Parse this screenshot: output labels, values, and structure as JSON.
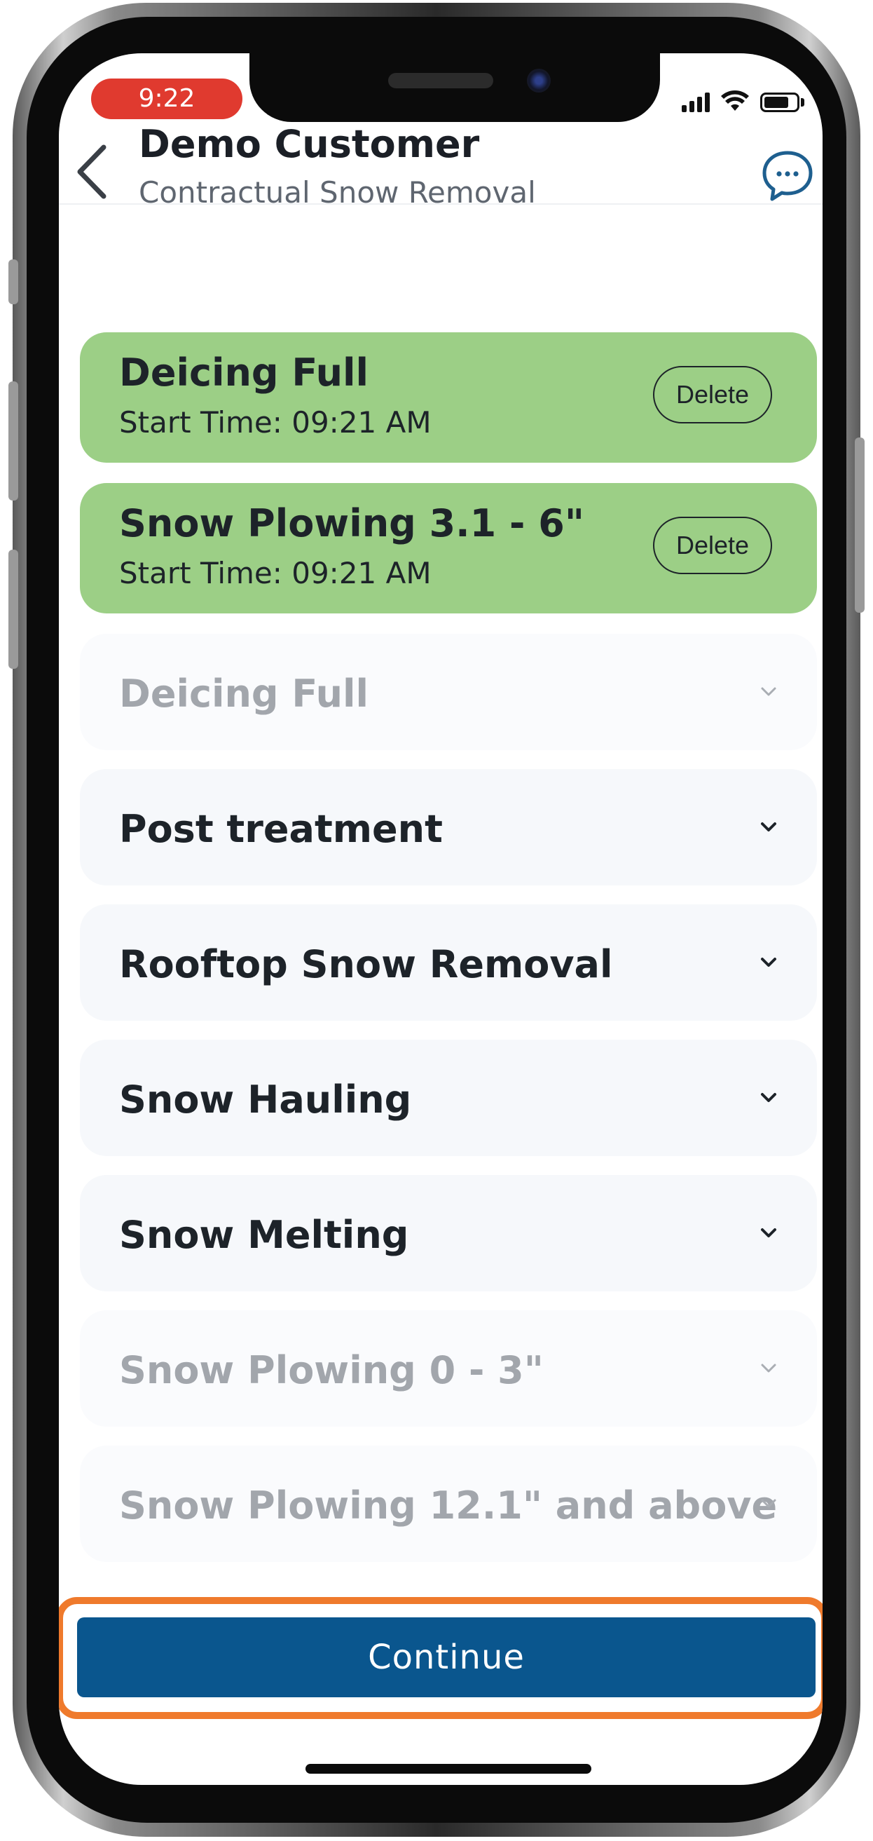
{
  "status_bar": {
    "time": "9:22"
  },
  "header": {
    "title": "Demo Customer",
    "subtitle": "Contractual Snow Removal",
    "back_icon": "chevron-left-icon",
    "chat_icon": "chat-bubble-icon"
  },
  "active_services": [
    {
      "name": "Deicing Full",
      "start": "Start Time: 09:21 AM",
      "action": "Delete"
    },
    {
      "name": "Snow Plowing 3.1 - 6\"",
      "start": "Start Time: 09:21 AM",
      "action": "Delete"
    }
  ],
  "services": [
    {
      "name": "Deicing Full",
      "disabled": true
    },
    {
      "name": "Post treatment",
      "disabled": false
    },
    {
      "name": "Rooftop Snow Removal",
      "disabled": false
    },
    {
      "name": "Snow Hauling",
      "disabled": false
    },
    {
      "name": "Snow Melting",
      "disabled": false
    },
    {
      "name": "Snow Plowing 0 - 3\"",
      "disabled": true
    },
    {
      "name": "Snow Plowing 12.1\" and above",
      "disabled": true
    }
  ],
  "continue_label": "Continue",
  "colors": {
    "active_card": "#9ccf86",
    "primary": "#0a568e",
    "highlight": "#ef7a2c",
    "time_pill": "#e03a2f"
  }
}
